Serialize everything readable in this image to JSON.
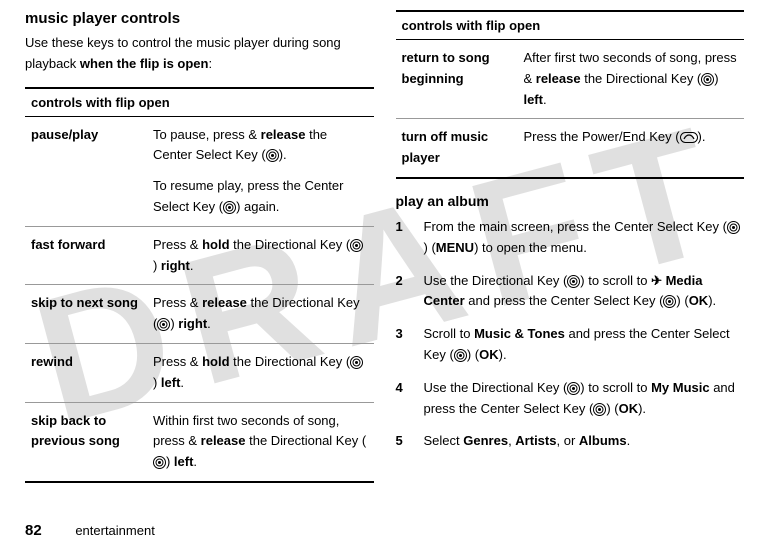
{
  "watermark": "DRAFT",
  "left": {
    "title": "music player controls",
    "intro_a": "Use these keys to control the music player during song playback ",
    "intro_b": "when the flip is open",
    "intro_c": ":",
    "table_header": "controls with flip open",
    "rows": {
      "r0": {
        "label": "pause/play",
        "d1a": "To pause, press & ",
        "d1b": "release",
        "d1c": " the Center Select Key (",
        "d1d": ").",
        "d2a": "To resume play, press the Center Select Key (",
        "d2b": ") again."
      },
      "r1": {
        "label": "fast forward",
        "a": "Press & ",
        "b": "hold",
        "c": " the Directional Key (",
        "d": ") ",
        "e": "right",
        "f": "."
      },
      "r2": {
        "label": "skip to next song",
        "a": "Press & ",
        "b": "release",
        "c": " the Directional Key (",
        "d": ") ",
        "e": "right",
        "f": "."
      },
      "r3": {
        "label": "rewind",
        "a": "Press & ",
        "b": "hold",
        "c": " the Directional Key (",
        "d": ") ",
        "e": "left",
        "f": "."
      },
      "r4": {
        "label": "skip back to previous song",
        "a": "Within first two seconds of song, press & ",
        "b": "release",
        "c": " the Directional Key (",
        "d": ") ",
        "e": "left",
        "f": "."
      }
    }
  },
  "right": {
    "table_header": "controls with flip open",
    "rows": {
      "r0": {
        "label": "return to song beginning",
        "a": "After first two seconds of song, press & ",
        "b": "release",
        "c": " the Directional Key (",
        "d": ") ",
        "e": "left",
        "f": "."
      },
      "r1": {
        "label": "turn off music player",
        "a": "Press the Power/End Key (",
        "b": ")."
      }
    },
    "subsection": "play an album",
    "steps": {
      "s1a": "From the main screen, press the Center Select Key (",
      "s1b": ") (",
      "s1c": "MENU",
      "s1d": ") to open the menu.",
      "s2a": "Use the Directional Key (",
      "s2b": ") to scroll to ",
      "s2c": " Media Center",
      "s2d": " and press the Center Select Key (",
      "s2e": ") (",
      "s2f": "OK",
      "s2g": ").",
      "s3a": "Scroll to ",
      "s3b": "Music & Tones",
      "s3c": " and press the Center Select Key (",
      "s3d": ") (",
      "s3e": "OK",
      "s3f": ").",
      "s4a": "Use the Directional Key (",
      "s4b": ") to scroll to ",
      "s4c": "My Music",
      "s4d": " and press the Center Select Key (",
      "s4e": ") (",
      "s4f": "OK",
      "s4g": ").",
      "s5a": "Select ",
      "s5b": "Genres",
      "s5c": ", ",
      "s5d": "Artists",
      "s5e": ", or ",
      "s5f": "Albums",
      "s5g": "."
    }
  },
  "footer": {
    "page": "82",
    "section": "entertainment"
  }
}
